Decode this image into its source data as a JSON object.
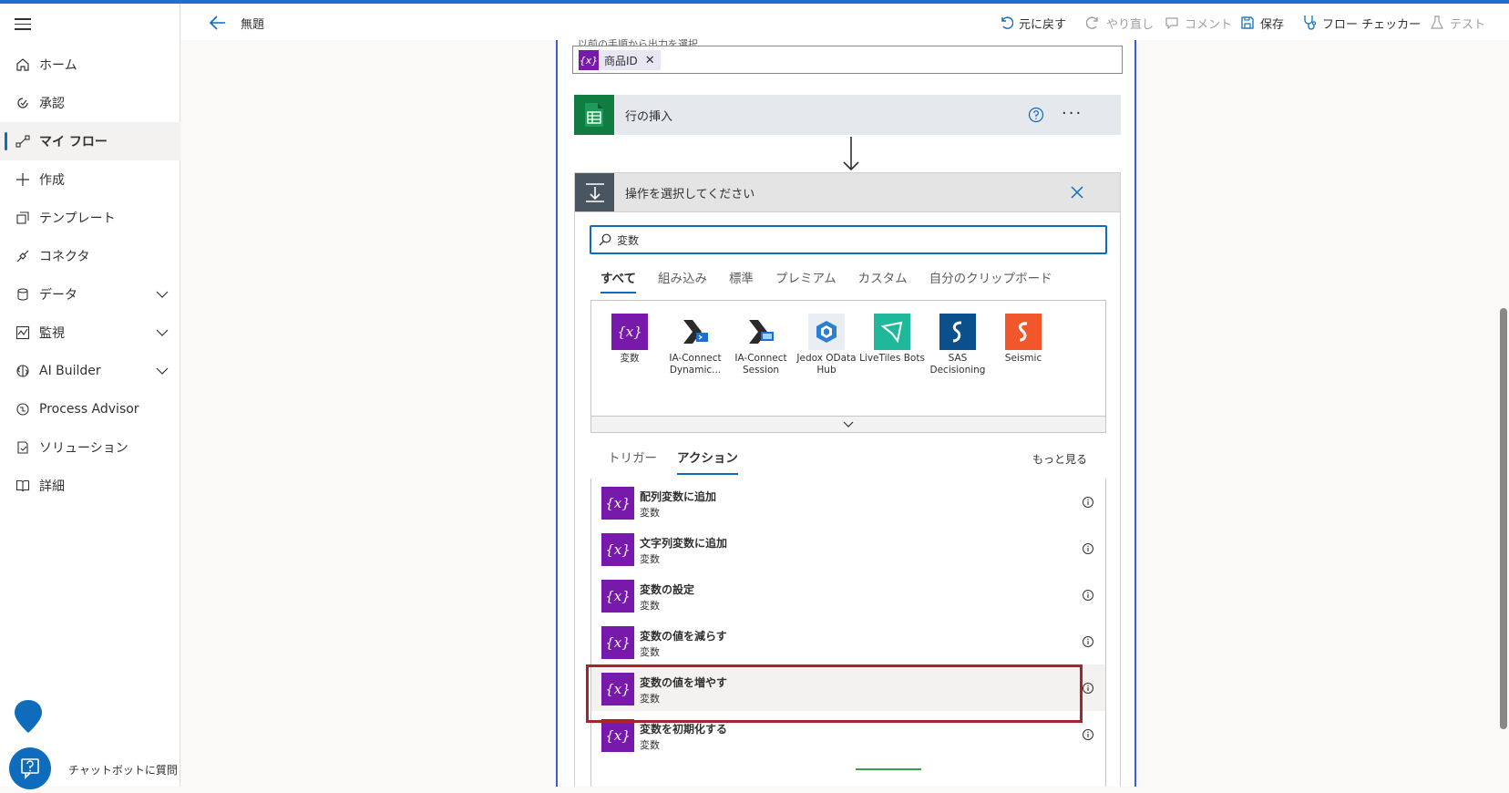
{
  "header": {
    "title": "無題",
    "undo": "元に戻す",
    "redo": "やり直し",
    "comment": "コメント",
    "save": "保存",
    "flow_checker": "フロー チェッカー",
    "test": "テスト"
  },
  "sidebar": {
    "items": [
      {
        "label": "ホーム"
      },
      {
        "label": "承認"
      },
      {
        "label": "マイ フロー"
      },
      {
        "label": "作成"
      },
      {
        "label": "テンプレート"
      },
      {
        "label": "コネクタ"
      },
      {
        "label": "データ"
      },
      {
        "label": "監視"
      },
      {
        "label": "AI Builder"
      },
      {
        "label": "Process Advisor"
      },
      {
        "label": "ソリューション"
      },
      {
        "label": "詳細"
      }
    ],
    "chatbot_label": "チャットボットに質問"
  },
  "canvas": {
    "field_label": "以前の手順から出力を選択",
    "token_label": "商品ID",
    "token_icon": "{x}",
    "insert_row_title": "行の挿入",
    "choose_action_title": "操作を選択してください"
  },
  "picker": {
    "search_value": "変数",
    "tabs": [
      "すべて",
      "組み込み",
      "標準",
      "プレミアム",
      "カスタム",
      "自分のクリップボード"
    ],
    "connectors": [
      {
        "label1": "変数",
        "label2": ""
      },
      {
        "label1": "IA-Connect",
        "label2": "Dynamic..."
      },
      {
        "label1": "IA-Connect",
        "label2": "Session"
      },
      {
        "label1": "Jedox OData",
        "label2": "Hub"
      },
      {
        "label1": "LiveTiles Bots",
        "label2": ""
      },
      {
        "label1": "SAS",
        "label2": "Decisioning"
      },
      {
        "label1": "Seismic",
        "label2": ""
      }
    ],
    "subtabs": [
      "トリガー",
      "アクション"
    ],
    "more": "もっと見る",
    "actions": [
      {
        "name": "配列変数に追加",
        "connector": "変数"
      },
      {
        "name": "文字列変数に追加",
        "connector": "変数"
      },
      {
        "name": "変数の設定",
        "connector": "変数"
      },
      {
        "name": "変数の値を減らす",
        "connector": "変数"
      },
      {
        "name": "変数の値を増やす",
        "connector": "変数"
      },
      {
        "name": "変数を初期化する",
        "connector": "変数"
      }
    ]
  },
  "colors": {
    "accent": "#0f6cbd",
    "variable": "#7719aa",
    "highlight": "#a4262c"
  }
}
